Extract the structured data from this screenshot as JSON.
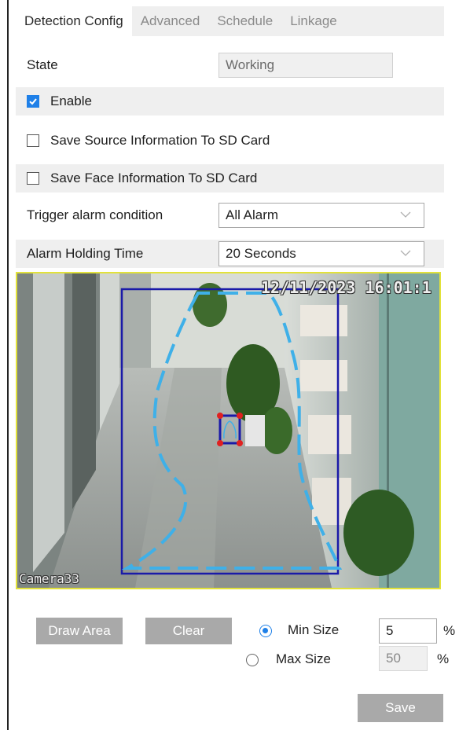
{
  "tabs": [
    {
      "label": "Detection Config",
      "active": true
    },
    {
      "label": "Advanced",
      "active": false
    },
    {
      "label": "Schedule",
      "active": false
    },
    {
      "label": "Linkage",
      "active": false
    }
  ],
  "state": {
    "label": "State",
    "value": "Working"
  },
  "enable": {
    "label": "Enable",
    "checked": true
  },
  "save_source": {
    "label": "Save Source Information To SD Card",
    "checked": false
  },
  "save_face": {
    "label": "Save Face Information To SD Card",
    "checked": false
  },
  "trigger": {
    "label": "Trigger alarm condition",
    "value": "All Alarm"
  },
  "holding": {
    "label": "Alarm Holding Time",
    "value": "20 Seconds"
  },
  "video": {
    "timestamp": "12/11/2023 16:01:1",
    "camera_name": "Camera33"
  },
  "controls": {
    "draw_area": "Draw Area",
    "clear": "Clear",
    "min_size": {
      "label": "Min Size",
      "value": "5",
      "unit": "%",
      "selected": true
    },
    "max_size": {
      "label": "Max Size",
      "value": "50",
      "unit": "%",
      "selected": false
    },
    "save": "Save"
  },
  "colors": {
    "accent": "#1f80e8",
    "detection_box": "#1a1aa8",
    "face_box": "#1a1aa8",
    "face_corner": "#e02020",
    "area_outline": "#3fb0e8",
    "video_border": "#e2e23a"
  }
}
